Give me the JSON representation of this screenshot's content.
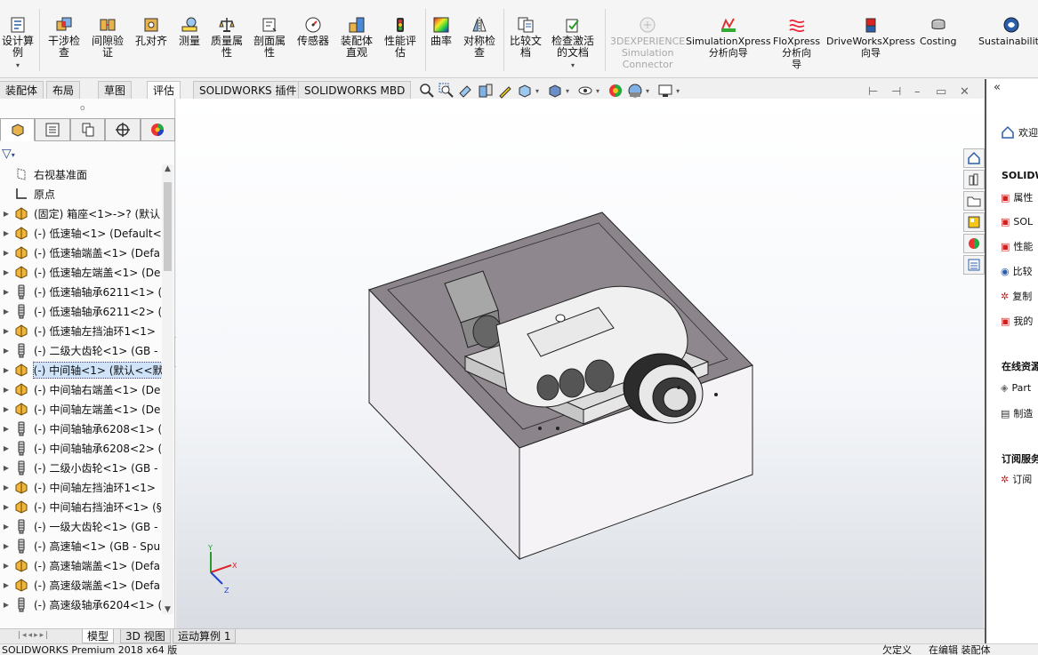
{
  "ribbon": {
    "buttons": [
      {
        "id": "design-study",
        "label": "设计算\n例",
        "icon": "design-study-icon",
        "dropdown": true
      },
      {
        "id": "interference",
        "label": "干涉检\n查",
        "icon": "interference-icon"
      },
      {
        "id": "clearance",
        "label": "间隙验\n证",
        "icon": "clearance-icon"
      },
      {
        "id": "hole-align",
        "label": "孔对齐",
        "icon": "hole-align-icon"
      },
      {
        "id": "measure",
        "label": "测量",
        "icon": "measure-icon"
      },
      {
        "id": "mass-props",
        "label": "质量属\n性",
        "icon": "mass-properties-icon"
      },
      {
        "id": "section-props",
        "label": "剖面属\n性",
        "icon": "section-properties-icon"
      },
      {
        "id": "sensor",
        "label": "传感器",
        "icon": "sensor-icon"
      },
      {
        "id": "assembly-visual",
        "label": "装配体\n直观",
        "icon": "assembly-visualization-icon"
      },
      {
        "id": "performance",
        "label": "性能评\n估",
        "icon": "performance-evaluation-icon"
      },
      {
        "id": "curvature",
        "label": "曲率",
        "icon": "curvature-icon"
      },
      {
        "id": "symmetry",
        "label": "对称检\n查",
        "icon": "symmetry-check-icon"
      },
      {
        "id": "compare",
        "label": "比较文\n档",
        "icon": "compare-documents-icon"
      },
      {
        "id": "check-active",
        "label": "检查激活\n的文档",
        "icon": "check-active-document-icon",
        "dropdown": true
      },
      {
        "id": "3dx",
        "label": "3DEXPERIENCE\nSimulation\nConnector",
        "icon": "3dexperience-icon",
        "disabled": true
      },
      {
        "id": "simxpress",
        "label": "SimulationXpress\n分析向导",
        "icon": "simulationxpress-icon"
      },
      {
        "id": "floxpress",
        "label": "FloXpress\n分析向\n导",
        "icon": "floxpress-icon"
      },
      {
        "id": "driveworks",
        "label": "DriveWorksXpress\n向导",
        "icon": "driveworksxpress-icon"
      },
      {
        "id": "costing",
        "label": "Costing",
        "icon": "costing-icon"
      },
      {
        "id": "sustainability",
        "label": "Sustainability",
        "icon": "sustainability-icon"
      }
    ]
  },
  "command_tabs": [
    "装配体",
    "布局",
    "草图",
    "评估",
    "SOLIDWORKS 插件",
    "SOLIDWORKS MBD"
  ],
  "active_command_tab": "评估",
  "feature_manager": {
    "tabs": [
      "featuremanager-icon",
      "propertymanager-icon",
      "configurationmanager-icon",
      "dimxpertmanager-icon",
      "displaymanager-icon"
    ],
    "tree": [
      {
        "label": "右视基准面",
        "icon": "plane-icon",
        "expand": false
      },
      {
        "label": "原点",
        "icon": "origin-icon",
        "expand": false
      },
      {
        "label": "(固定) 箱座<1>->? (默认",
        "icon": "part-icon",
        "expand": true
      },
      {
        "label": "(-) 低速轴<1> (Default<",
        "icon": "part-icon",
        "expand": true
      },
      {
        "label": "(-) 低速轴端盖<1> (Defa",
        "icon": "part-icon",
        "expand": true
      },
      {
        "label": "(-) 低速轴左端盖<1> (De",
        "icon": "part-icon",
        "expand": true
      },
      {
        "label": "(-) 低速轴轴承6211<1> (",
        "icon": "toolbox-icon",
        "expand": true
      },
      {
        "label": "(-) 低速轴轴承6211<2> (",
        "icon": "toolbox-icon",
        "expand": true
      },
      {
        "label": "(-) 低速轴左挡油环1<1>",
        "icon": "part-icon",
        "expand": true
      },
      {
        "label": "(-) 二级大齿轮<1> (GB -",
        "icon": "toolbox-icon",
        "expand": true
      },
      {
        "label": "(-) 中间轴<1> (默认<<默",
        "icon": "part-icon",
        "expand": true,
        "selected": true
      },
      {
        "label": "(-) 中间轴右端盖<1> (De",
        "icon": "part-icon",
        "expand": true
      },
      {
        "label": "(-) 中间轴左端盖<1> (De",
        "icon": "part-icon",
        "expand": true
      },
      {
        "label": "(-) 中间轴轴承6208<1> (",
        "icon": "toolbox-icon",
        "expand": true
      },
      {
        "label": "(-) 中间轴轴承6208<2> (",
        "icon": "toolbox-icon",
        "expand": true
      },
      {
        "label": "(-) 二级小齿轮<1> (GB -",
        "icon": "toolbox-icon",
        "expand": true
      },
      {
        "label": "(-) 中间轴左挡油环1<1>",
        "icon": "part-icon",
        "expand": true
      },
      {
        "label": "(-) 中间轴右挡油环<1> (§",
        "icon": "part-icon",
        "expand": true
      },
      {
        "label": "(-) 一级大齿轮<1> (GB -",
        "icon": "toolbox-icon",
        "expand": true
      },
      {
        "label": "(-) 高速轴<1> (GB - Spu",
        "icon": "toolbox-icon",
        "expand": true
      },
      {
        "label": "(-) 高速轴端盖<1> (Defa",
        "icon": "part-icon",
        "expand": true
      },
      {
        "label": "(-) 高速级端盖<1> (Defa",
        "icon": "part-icon",
        "expand": true
      },
      {
        "label": "(-) 高速级轴承6204<1> (",
        "icon": "toolbox-icon",
        "expand": true
      }
    ]
  },
  "bottom_tabs": [
    "模型",
    "3D 视图",
    "运动算例 1"
  ],
  "active_bottom_tab": "模型",
  "status": {
    "app": "SOLIDWORKS Premium 2018 x64 版",
    "custom": "欠定义",
    "editing": "在编辑 装配体"
  },
  "task_pane": {
    "welcome": "欢迎",
    "section1": "SOLIDW",
    "items1": [
      "属性",
      "SOL",
      "性能",
      "比较",
      "复制",
      "我的"
    ],
    "section2": "在线资源",
    "items2": [
      "Part",
      "制造"
    ],
    "section3": "订阅服务",
    "items3": [
      "订阅"
    ]
  },
  "colors": {
    "accent": "#2b5ea8",
    "box_gray": "#8b848a",
    "tree_selection": "#cfe3f9"
  }
}
